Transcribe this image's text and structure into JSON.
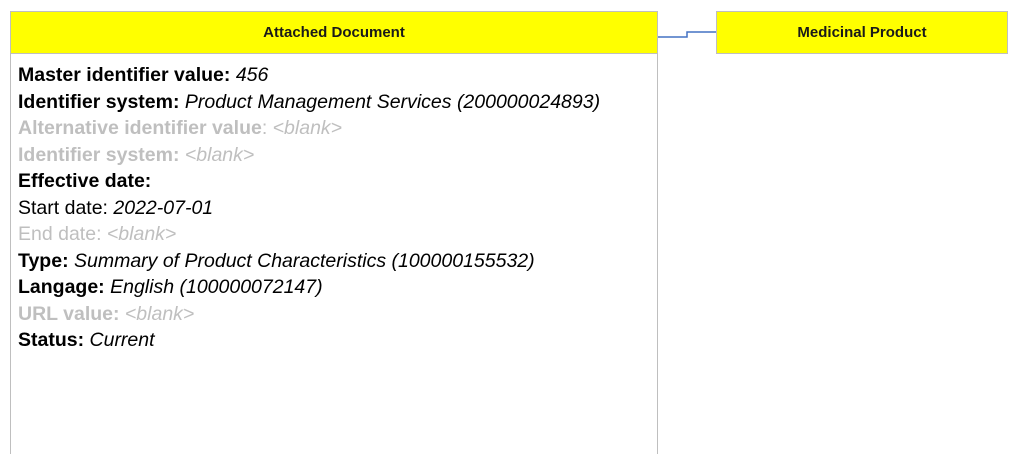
{
  "attached_document": {
    "title": "Attached Document",
    "fields": [
      {
        "label": "Master identifier value:",
        "value": "456",
        "style": "normal"
      },
      {
        "label": "Identifier system:",
        "value": "Product Management Services (200000024893)",
        "style": "normal"
      },
      {
        "label": "Alternative identifier value",
        "sep": ":",
        "value": "<blank>",
        "style": "muted"
      },
      {
        "label": "Identifier system:",
        "value": "<blank>",
        "style": "muted"
      },
      {
        "label": "Effective date:",
        "value": "",
        "style": "normal"
      },
      {
        "label": "Start date:",
        "value": "2022-07-01",
        "style": "normal-plain"
      },
      {
        "label": "End date:",
        "value": "<blank>",
        "style": "muted-plain"
      },
      {
        "label": "Type:",
        "value": "Summary of Product Characteristics (100000155532)",
        "style": "normal"
      },
      {
        "label": "Langage:",
        "value": "English (100000072147)",
        "style": "normal"
      },
      {
        "label": "URL value:",
        "value": "<blank>",
        "style": "muted"
      },
      {
        "label": "Status:",
        "value": "Current",
        "style": "normal"
      }
    ]
  },
  "medicinal_product": {
    "title": "Medicinal Product"
  },
  "colors": {
    "header_fill": "#ffff00",
    "border": "#bfbfbf",
    "connector": "#4472c4",
    "muted_text": "#bfbfbf"
  }
}
